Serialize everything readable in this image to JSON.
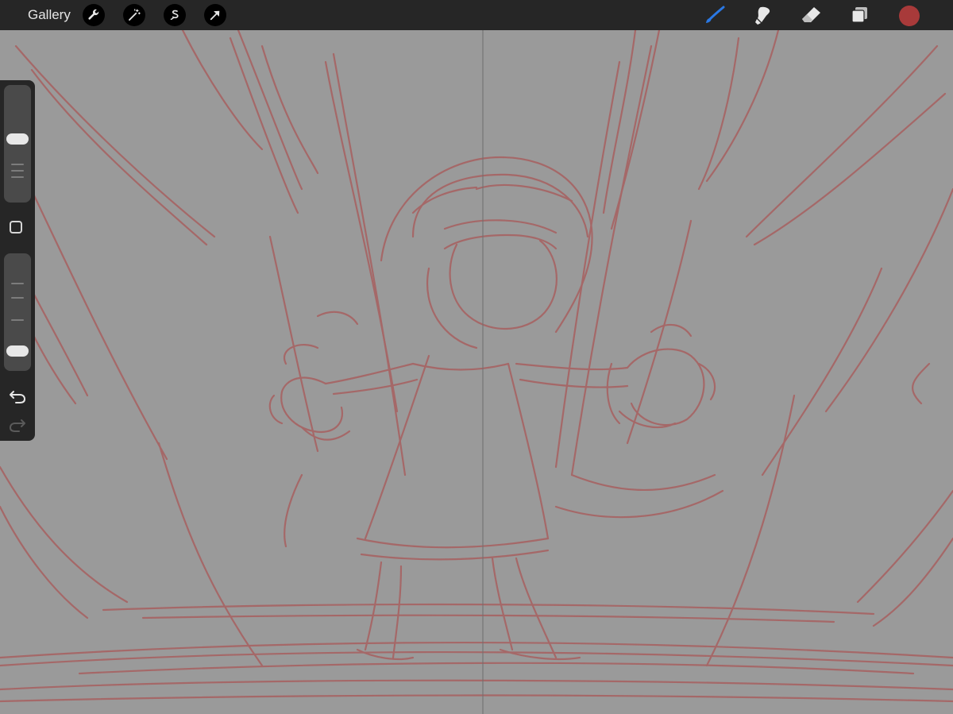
{
  "topbar": {
    "gallery_label": "Gallery",
    "left_tools": [
      {
        "icon": "wrench-icon",
        "name": "actions-button"
      },
      {
        "icon": "magic-wand-icon",
        "name": "adjustments-button"
      },
      {
        "icon": "selection-s-icon",
        "name": "selection-button"
      },
      {
        "icon": "arrow-cursor-icon",
        "name": "transform-button"
      }
    ],
    "right_tools": [
      {
        "icon": "brush-icon",
        "name": "paint-tool-button",
        "active": true
      },
      {
        "icon": "smudge-icon",
        "name": "smudge-tool-button",
        "active": false
      },
      {
        "icon": "eraser-icon",
        "name": "eraser-tool-button",
        "active": false
      },
      {
        "icon": "layers-icon",
        "name": "layers-button",
        "active": false
      }
    ],
    "current_color": "#a83a3a"
  },
  "sidebar": {
    "brush_size_level": 0.55,
    "opacity_level": 0.12,
    "modify_button_icon": "square-icon",
    "undo_icon": "undo-arrow-icon",
    "redo_icon": "redo-arrow-icon",
    "redo_enabled": false
  },
  "colors": {
    "toolbar_bg": "#262626",
    "canvas_bg": "#9a9a9a",
    "sketch_stroke": "#a86060",
    "active_tool": "#2a78e4"
  }
}
